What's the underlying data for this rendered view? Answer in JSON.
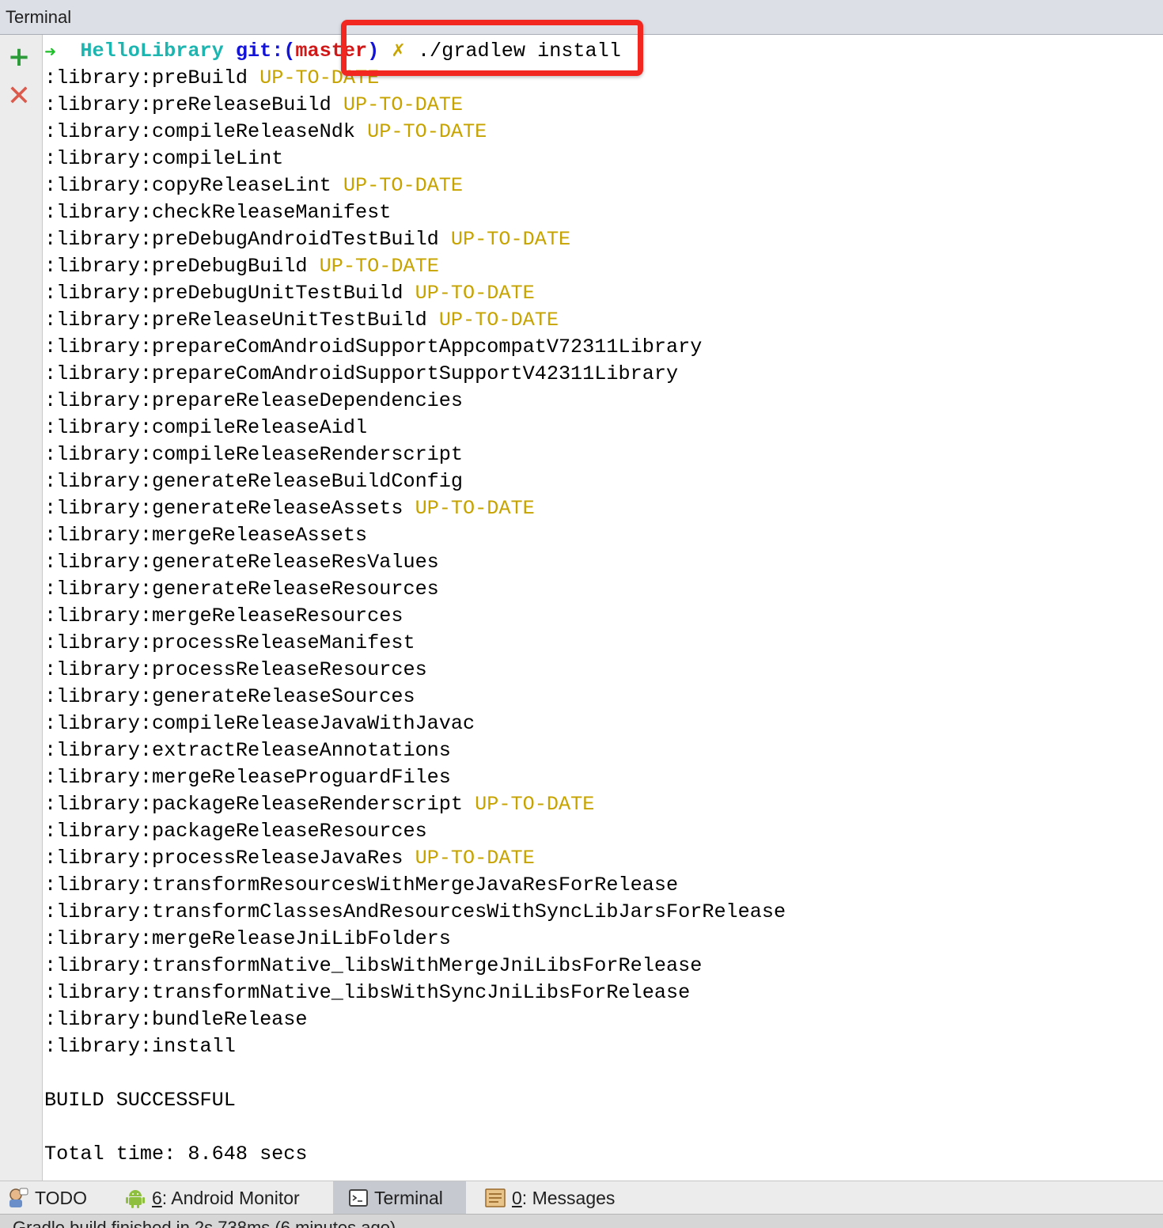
{
  "window": {
    "title": "Terminal"
  },
  "toolbar": {
    "add_icon": "plus-icon",
    "close_icon": "close-icon"
  },
  "prompt": {
    "arrow": "➜",
    "dir": "HelloLibrary",
    "git_prefix": "git:(",
    "branch": "master",
    "git_suffix": ")",
    "dirty_mark": "✗",
    "command": "./gradlew install"
  },
  "output": {
    "lines": [
      {
        "task": ":library:preBuild",
        "status": "UP-TO-DATE"
      },
      {
        "task": ":library:preReleaseBuild",
        "status": "UP-TO-DATE"
      },
      {
        "task": ":library:compileReleaseNdk",
        "status": "UP-TO-DATE"
      },
      {
        "task": ":library:compileLint",
        "status": ""
      },
      {
        "task": ":library:copyReleaseLint",
        "status": "UP-TO-DATE"
      },
      {
        "task": ":library:checkReleaseManifest",
        "status": ""
      },
      {
        "task": ":library:preDebugAndroidTestBuild",
        "status": "UP-TO-DATE"
      },
      {
        "task": ":library:preDebugBuild",
        "status": "UP-TO-DATE"
      },
      {
        "task": ":library:preDebugUnitTestBuild",
        "status": "UP-TO-DATE"
      },
      {
        "task": ":library:preReleaseUnitTestBuild",
        "status": "UP-TO-DATE"
      },
      {
        "task": ":library:prepareComAndroidSupportAppcompatV72311Library",
        "status": ""
      },
      {
        "task": ":library:prepareComAndroidSupportSupportV42311Library",
        "status": ""
      },
      {
        "task": ":library:prepareReleaseDependencies",
        "status": ""
      },
      {
        "task": ":library:compileReleaseAidl",
        "status": ""
      },
      {
        "task": ":library:compileReleaseRenderscript",
        "status": ""
      },
      {
        "task": ":library:generateReleaseBuildConfig",
        "status": ""
      },
      {
        "task": ":library:generateReleaseAssets",
        "status": "UP-TO-DATE"
      },
      {
        "task": ":library:mergeReleaseAssets",
        "status": ""
      },
      {
        "task": ":library:generateReleaseResValues",
        "status": ""
      },
      {
        "task": ":library:generateReleaseResources",
        "status": ""
      },
      {
        "task": ":library:mergeReleaseResources",
        "status": ""
      },
      {
        "task": ":library:processReleaseManifest",
        "status": ""
      },
      {
        "task": ":library:processReleaseResources",
        "status": ""
      },
      {
        "task": ":library:generateReleaseSources",
        "status": ""
      },
      {
        "task": ":library:compileReleaseJavaWithJavac",
        "status": ""
      },
      {
        "task": ":library:extractReleaseAnnotations",
        "status": ""
      },
      {
        "task": ":library:mergeReleaseProguardFiles",
        "status": ""
      },
      {
        "task": ":library:packageReleaseRenderscript",
        "status": "UP-TO-DATE"
      },
      {
        "task": ":library:packageReleaseResources",
        "status": ""
      },
      {
        "task": ":library:processReleaseJavaRes",
        "status": "UP-TO-DATE"
      },
      {
        "task": ":library:transformResourcesWithMergeJavaResForRelease",
        "status": ""
      },
      {
        "task": ":library:transformClassesAndResourcesWithSyncLibJarsForRelease",
        "status": ""
      },
      {
        "task": ":library:mergeReleaseJniLibFolders",
        "status": ""
      },
      {
        "task": ":library:transformNative_libsWithMergeJniLibsForRelease",
        "status": ""
      },
      {
        "task": ":library:transformNative_libsWithSyncJniLibsForRelease",
        "status": ""
      },
      {
        "task": ":library:bundleRelease",
        "status": ""
      },
      {
        "task": ":library:install",
        "status": ""
      }
    ],
    "build_result": "BUILD SUCCESSFUL",
    "total_time": "Total time: 8.648 secs"
  },
  "bottom_tabs": [
    {
      "id": "todo",
      "icon": "todo-icon",
      "mnemonic": "",
      "label": "TODO"
    },
    {
      "id": "monitor",
      "icon": "android-icon",
      "mnemonic": "6",
      "label": ": Android Monitor"
    },
    {
      "id": "terminal",
      "icon": "terminal-icon",
      "mnemonic": "",
      "label": "Terminal"
    },
    {
      "id": "messages",
      "icon": "messages-icon",
      "mnemonic": "0",
      "label": ": Messages"
    }
  ],
  "status_bar": {
    "text": "Gradle build finished in 2s 738ms (6 minutes ago)"
  },
  "colors": {
    "highlight_box": "#f2271f",
    "up_to_date": "#c7a300",
    "prompt_dir": "#1cb5b0",
    "git": "#1414d8",
    "branch": "#d01818"
  }
}
